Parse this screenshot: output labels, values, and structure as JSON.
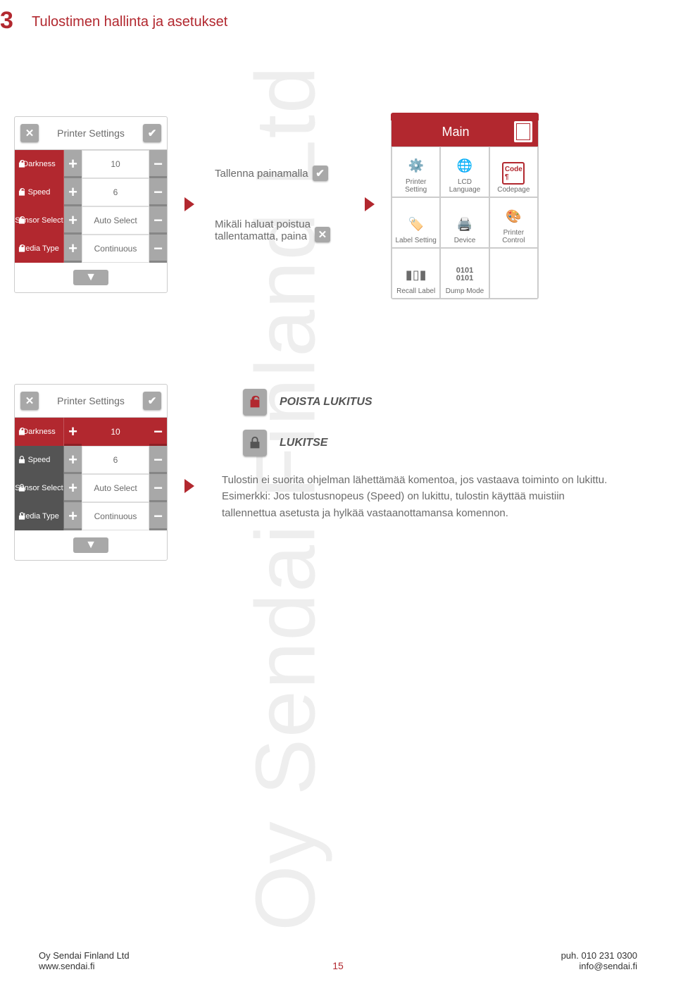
{
  "section": {
    "number": "3",
    "title": "Tulostimen hallinta ja asetukset"
  },
  "watermark": "Oy Sendai Finland Ltd",
  "panel1": {
    "title": "Printer Settings",
    "rows": [
      {
        "label": "Darkness",
        "value": "10",
        "locked": false
      },
      {
        "label": "Speed",
        "value": "6",
        "locked": false
      },
      {
        "label": "Sensor Select",
        "value": "Auto Select",
        "locked": false
      },
      {
        "label": "Media Type",
        "value": "Continuous",
        "locked": false
      }
    ]
  },
  "instr1": "Tallenna painamalla",
  "instr2a": "Mikäli haluat poistua",
  "instr2b": "tallentamatta, paina",
  "main": {
    "title": "Main",
    "tiles": [
      "Printer Setting",
      "LCD Language",
      "Codepage",
      "Label Setting",
      "Device",
      "Printer Control",
      "Recall Label",
      "Dump Mode",
      ""
    ]
  },
  "panel2": {
    "title": "Printer Settings",
    "rows": [
      {
        "label": "Darkness",
        "value": "10",
        "locked": false
      },
      {
        "label": "Speed",
        "value": "6",
        "locked": true
      },
      {
        "label": "Sensor Select",
        "value": "Auto Select",
        "locked": true
      },
      {
        "label": "Media Type",
        "value": "Continuous",
        "locked": true
      }
    ]
  },
  "unlock_label": "POISTA LUKITUS",
  "lock_label": "LUKITSE",
  "body": "Tulostin ei suorita ohjelman lähettämää komentoa, jos vastaava toiminto on lukittu. Esimerkki: Jos tulostusnopeus (Speed) on lukittu, tulostin käyttää muistiin tallennettua asetusta ja hylkää vastaanottamansa komennon.",
  "footer": {
    "company": "Oy Sendai Finland Ltd",
    "web": "www.sendai.fi",
    "page": "15",
    "phone": "puh. 010 231 0300",
    "email": "info@sendai.fi"
  },
  "pm": {
    "plus": "+",
    "minus": "−"
  }
}
